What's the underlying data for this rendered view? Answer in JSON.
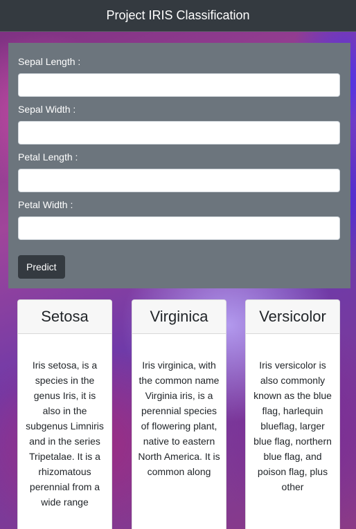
{
  "navbar": {
    "title": "Project IRIS Classification"
  },
  "form": {
    "fields": [
      {
        "label": "Sepal Length :",
        "value": "",
        "placeholder": ""
      },
      {
        "label": "Sepal Width :",
        "value": "",
        "placeholder": ""
      },
      {
        "label": "Petal Length :",
        "value": "",
        "placeholder": ""
      },
      {
        "label": "Petal Width :",
        "value": "",
        "placeholder": ""
      }
    ],
    "submit_label": "Predict"
  },
  "cards": [
    {
      "title": "Setosa",
      "text": "Iris setosa, is a species in the genus Iris, it is also in the subgenus Limniris and in the series Tripetalae. It is a rhizomatous perennial from a wide range"
    },
    {
      "title": "Virginica",
      "text": "Iris virginica, with the common name Virginia iris, is a perennial species of flowering plant, native to eastern North America. It is common along"
    },
    {
      "title": "Versicolor",
      "text": "Iris versicolor is also commonly known as the blue flag, harlequin blueflag, larger blue flag, northern blue flag, and poison flag, plus other"
    }
  ],
  "colors": {
    "navbar_bg": "#343a40",
    "panel_bg": "#6c757d",
    "button_bg": "#343a40"
  }
}
